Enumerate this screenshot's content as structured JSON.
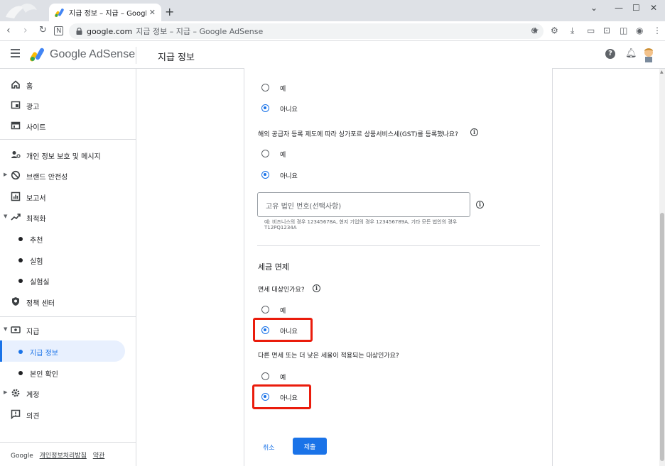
{
  "browser": {
    "tab_title": "지급 정보 – 지급 – Google AdSense",
    "url_host": "google.com",
    "url_rest": "지급 정보 – 지급 – Google AdSense"
  },
  "header": {
    "brand": "Google AdSense",
    "page_title": "지급 정보"
  },
  "sidebar": {
    "items": [
      {
        "label": "홈",
        "icon": "home-icon"
      },
      {
        "label": "광고",
        "icon": "ads-icon"
      },
      {
        "label": "사이트",
        "icon": "sites-icon"
      },
      {
        "label": "개인 정보 보호 및 메시지",
        "icon": "privacy-icon"
      },
      {
        "label": "브랜드 안전성",
        "icon": "block-icon"
      },
      {
        "label": "보고서",
        "icon": "report-icon"
      },
      {
        "label": "최적화",
        "icon": "trending-icon"
      },
      {
        "label": "추천"
      },
      {
        "label": "실험"
      },
      {
        "label": "실험실"
      },
      {
        "label": "정책 센터",
        "icon": "shield-icon"
      },
      {
        "label": "지급",
        "icon": "payments-icon"
      },
      {
        "label": "지급 정보"
      },
      {
        "label": "본인 확인"
      },
      {
        "label": "계정",
        "icon": "gear-icon"
      },
      {
        "label": "의견",
        "icon": "feedback-icon"
      }
    ],
    "footer": {
      "google": "Google",
      "privacy": "개인정보처리방침",
      "terms": "약관"
    }
  },
  "form": {
    "q0": {
      "yes": "예",
      "no": "아니요",
      "selected": "no"
    },
    "q1": {
      "text": "해외 공급자 등록 제도에 따라 싱가포르 상품서비스세(GST)를 등록했나요?",
      "yes": "예",
      "no": "아니요",
      "selected": "no"
    },
    "uen_field": {
      "placeholder": "고유 법인 번호(선택사항)",
      "hint": "예: 비즈니스의 경우 12345678A, 현지 기업의 경우 123456789A, 기타 모든 법인의 경우 T12PQ1234A"
    },
    "tax_section_title": "세금 면제",
    "q2": {
      "text": "면세 대상인가요?",
      "yes": "예",
      "no": "아니요",
      "selected": "no"
    },
    "q3": {
      "text": "다른 면세 또는 더 낮은 세율이 적용되는 대상인가요?",
      "yes": "예",
      "no": "아니요",
      "selected": "no"
    },
    "cancel": "취소",
    "submit": "제출"
  },
  "colors": {
    "accent": "#1a73e8",
    "highlight": "#ea1c0c"
  }
}
